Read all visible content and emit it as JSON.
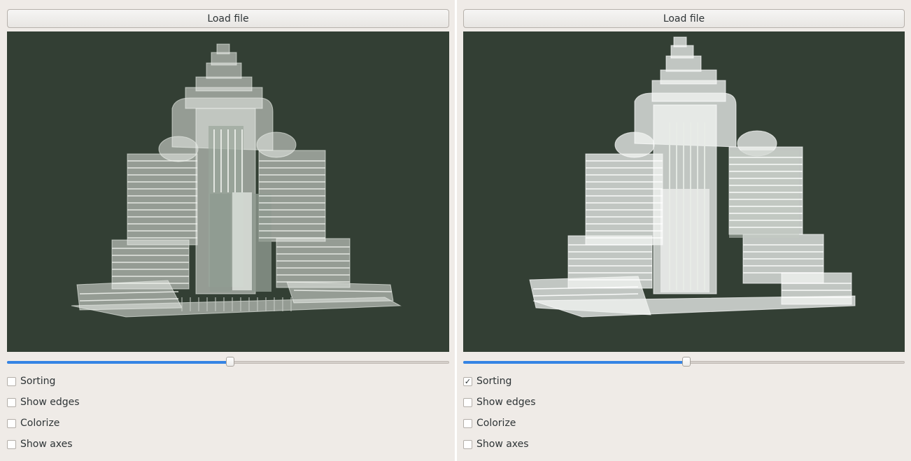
{
  "panels": [
    {
      "load_label": "Load file",
      "slider": {
        "value_fraction": 0.505
      },
      "options": [
        {
          "label": "Sorting",
          "checked": false,
          "mark": ""
        },
        {
          "label": "Show edges",
          "checked": false,
          "mark": ""
        },
        {
          "label": "Colorize",
          "checked": false,
          "mark": ""
        },
        {
          "label": "Show axes",
          "checked": false,
          "mark": ""
        }
      ],
      "viewport_background": "#333f34"
    },
    {
      "load_label": "Load file",
      "slider": {
        "value_fraction": 0.505
      },
      "options": [
        {
          "label": "Sorting",
          "checked": true,
          "mark": "✓"
        },
        {
          "label": "Show edges",
          "checked": false,
          "mark": ""
        },
        {
          "label": "Colorize",
          "checked": false,
          "mark": ""
        },
        {
          "label": "Show axes",
          "checked": false,
          "mark": ""
        }
      ],
      "viewport_background": "#333f34"
    }
  ],
  "colors": {
    "accent": "#3584e4",
    "window_bg": "#efebe7"
  }
}
